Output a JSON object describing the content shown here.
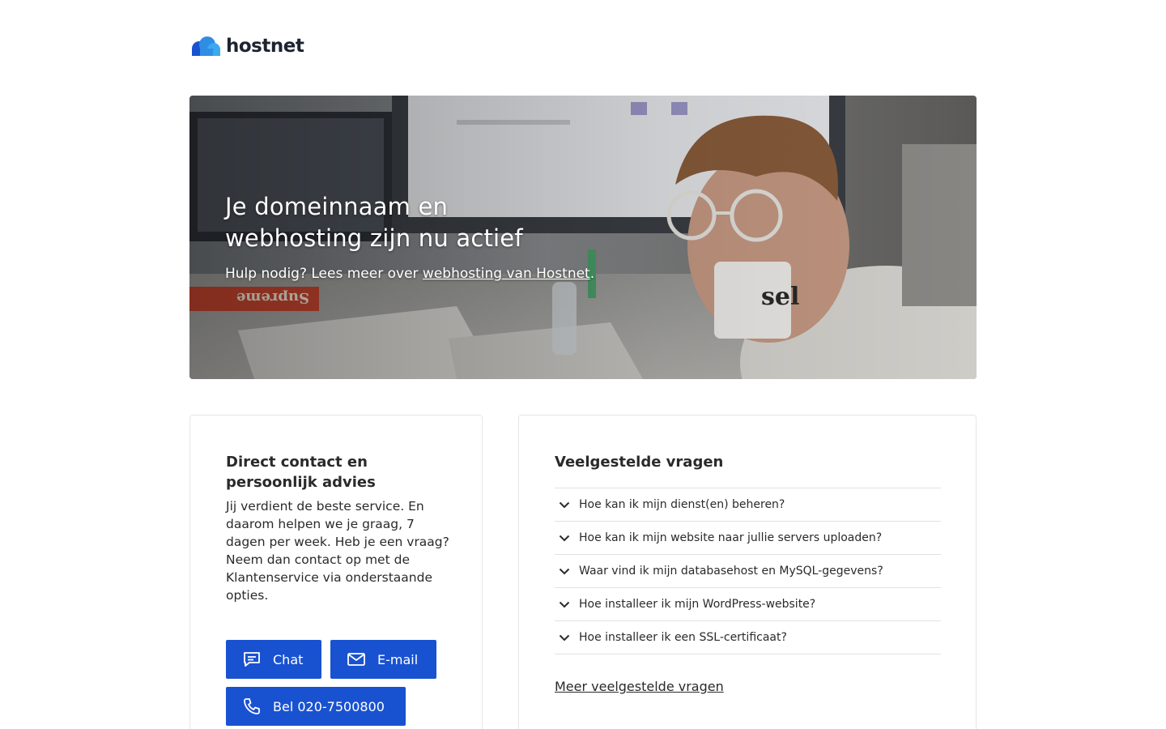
{
  "brand": {
    "name": "hostnet",
    "colors": {
      "cloud_dark": "#1952d1",
      "cloud_light": "#3aa9f0",
      "button": "#1952d1"
    }
  },
  "hero": {
    "title_line1": "Je domeinnaam en",
    "title_line2": "webhosting zijn nu actief",
    "subtitle_prefix": "Hulp nodig? Lees meer over ",
    "subtitle_link": "webhosting van Hostnet",
    "subtitle_suffix": ".",
    "image": {
      "icon": "office-photo",
      "mug_text": "sel",
      "box_text": "Supreme"
    }
  },
  "contact": {
    "title": "Direct contact en persoonlijk advies",
    "body": "Jij verdient de beste service. En daarom helpen we je graag, 7 dagen per week. Heb je een vraag? Neem dan contact op met de Klantenservice via onderstaande opties.",
    "buttons": {
      "chat": {
        "label": "Chat",
        "icon": "chat-bubble-icon"
      },
      "email": {
        "label": "E-mail",
        "icon": "mail-icon"
      },
      "call": {
        "label": "Bel 020-7500800",
        "icon": "phone-icon"
      }
    }
  },
  "faq": {
    "title": "Veelgestelde vragen",
    "items": [
      "Hoe kan ik mijn dienst(en) beheren?",
      "Hoe kan ik mijn website naar jullie servers uploaden?",
      "Waar vind ik mijn databasehost en MySQL-gegevens?",
      "Hoe installeer ik mijn WordPress-website?",
      "Hoe installeer ik een SSL-certificaat?"
    ],
    "more_link": "Meer veelgestelde vragen"
  }
}
